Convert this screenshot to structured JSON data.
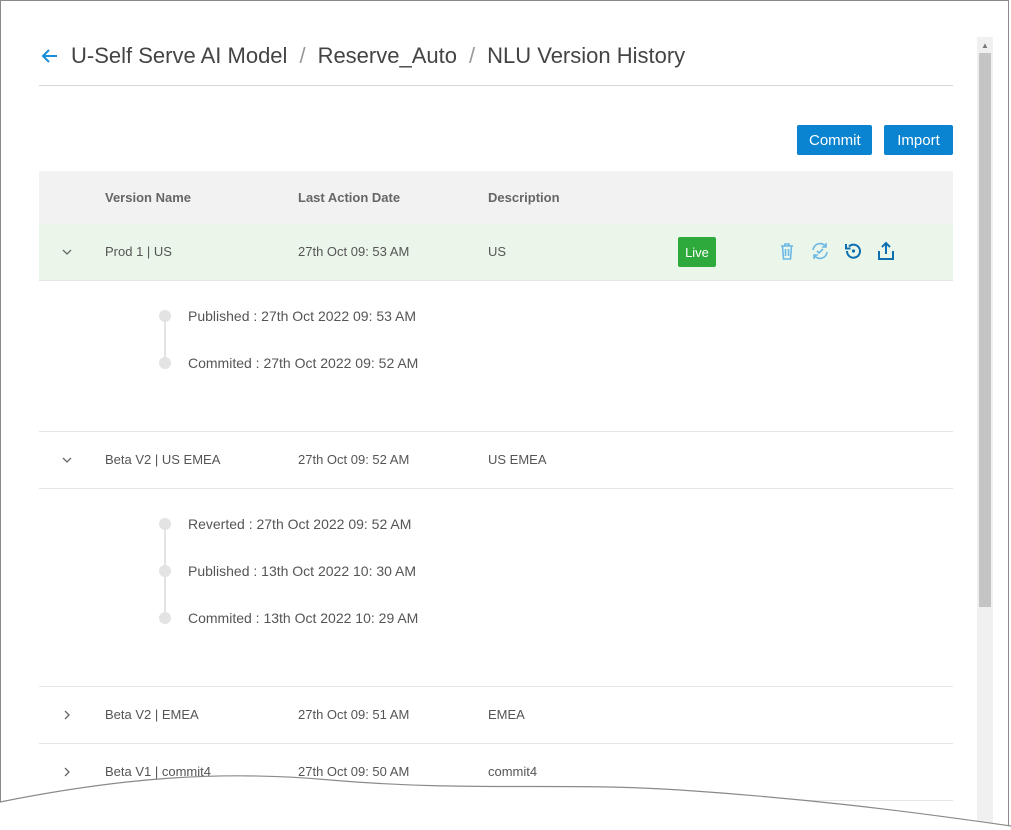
{
  "header": {
    "crumbs": [
      "U-Self Serve AI Model",
      "Reserve_Auto",
      "NLU Version History"
    ],
    "separator": "/"
  },
  "toolbar": {
    "commit_label": "Commit",
    "import_label": "Import"
  },
  "table": {
    "columns": [
      "Version Name",
      "Last Action Date",
      "Description"
    ],
    "rows": [
      {
        "name": "Prod 1 | US",
        "date": "27th Oct 09: 53 AM",
        "description": "US",
        "status": "Live",
        "expanded": true,
        "history": [
          "Published : 27th Oct 2022 09: 53 AM",
          "Commited : 27th Oct 2022 09: 52 AM"
        ]
      },
      {
        "name": "Beta V2 | US EMEA",
        "date": "27th Oct 09: 52 AM",
        "description": "US EMEA",
        "expanded": true,
        "history": [
          "Reverted : 27th Oct 2022 09: 52 AM",
          "Published : 13th Oct 2022 10: 30 AM",
          "Commited : 13th Oct 2022 10: 29 AM"
        ]
      },
      {
        "name": "Beta V2 | EMEA",
        "date": "27th Oct 09: 51 AM",
        "description": "EMEA",
        "expanded": false
      },
      {
        "name": "Beta V1 | commit4",
        "date": "27th Oct 09: 50 AM",
        "description": "commit4",
        "expanded": false
      }
    ]
  },
  "colors": {
    "accent": "#0a84d0",
    "live": "#2eaa3c",
    "live_row": "#eaf6ea",
    "icon": "#1a8fd8"
  },
  "icons": [
    "back-arrow-icon",
    "trash-icon",
    "sync-icon",
    "revert-icon",
    "export-icon",
    "chevron-down-icon",
    "chevron-right-icon"
  ]
}
